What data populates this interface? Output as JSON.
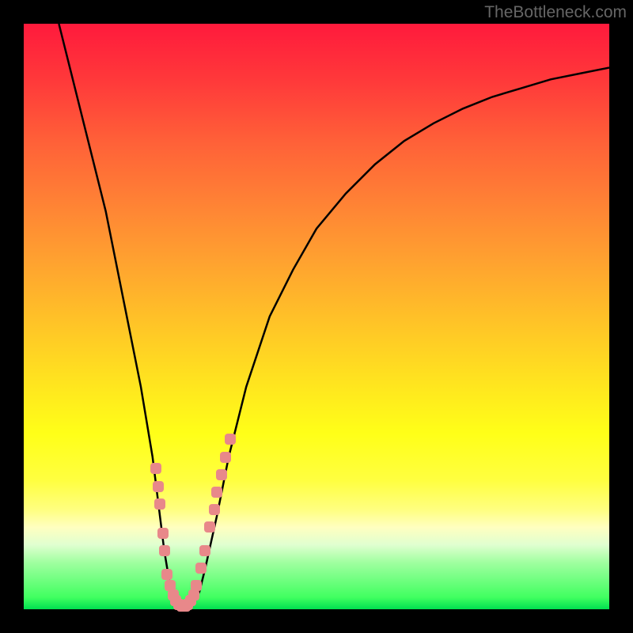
{
  "watermark": "TheBottleneck.com",
  "chart_data": {
    "type": "line",
    "title": "",
    "xlabel": "",
    "ylabel": "",
    "xlim": [
      0,
      100
    ],
    "ylim": [
      0,
      100
    ],
    "curve": [
      {
        "x": 6,
        "y": 100
      },
      {
        "x": 8,
        "y": 92
      },
      {
        "x": 10,
        "y": 84
      },
      {
        "x": 12,
        "y": 76
      },
      {
        "x": 14,
        "y": 68
      },
      {
        "x": 16,
        "y": 58
      },
      {
        "x": 18,
        "y": 48
      },
      {
        "x": 20,
        "y": 38
      },
      {
        "x": 22,
        "y": 26
      },
      {
        "x": 23,
        "y": 18
      },
      {
        "x": 24,
        "y": 10
      },
      {
        "x": 25,
        "y": 4
      },
      {
        "x": 26,
        "y": 1
      },
      {
        "x": 27,
        "y": 0
      },
      {
        "x": 28,
        "y": 0
      },
      {
        "x": 29,
        "y": 1
      },
      {
        "x": 30,
        "y": 3
      },
      {
        "x": 31,
        "y": 7
      },
      {
        "x": 33,
        "y": 16
      },
      {
        "x": 35,
        "y": 26
      },
      {
        "x": 38,
        "y": 38
      },
      {
        "x": 42,
        "y": 50
      },
      {
        "x": 46,
        "y": 58
      },
      {
        "x": 50,
        "y": 65
      },
      {
        "x": 55,
        "y": 71
      },
      {
        "x": 60,
        "y": 76
      },
      {
        "x": 65,
        "y": 80
      },
      {
        "x": 70,
        "y": 83
      },
      {
        "x": 75,
        "y": 85.5
      },
      {
        "x": 80,
        "y": 87.5
      },
      {
        "x": 85,
        "y": 89
      },
      {
        "x": 90,
        "y": 90.5
      },
      {
        "x": 95,
        "y": 91.5
      },
      {
        "x": 100,
        "y": 92.5
      }
    ],
    "markers": [
      {
        "x": 22.5,
        "y": 24
      },
      {
        "x": 23,
        "y": 21
      },
      {
        "x": 23.3,
        "y": 18
      },
      {
        "x": 23.8,
        "y": 13
      },
      {
        "x": 24,
        "y": 10
      },
      {
        "x": 24.5,
        "y": 6
      },
      {
        "x": 25,
        "y": 4
      },
      {
        "x": 25.5,
        "y": 2.5
      },
      {
        "x": 26,
        "y": 1.5
      },
      {
        "x": 26.5,
        "y": 0.8
      },
      {
        "x": 27,
        "y": 0.5
      },
      {
        "x": 27.5,
        "y": 0.5
      },
      {
        "x": 28,
        "y": 0.8
      },
      {
        "x": 28.5,
        "y": 1.5
      },
      {
        "x": 29,
        "y": 2.5
      },
      {
        "x": 29.5,
        "y": 4
      },
      {
        "x": 30.3,
        "y": 7
      },
      {
        "x": 31,
        "y": 10
      },
      {
        "x": 31.8,
        "y": 14
      },
      {
        "x": 32.5,
        "y": 17
      },
      {
        "x": 33,
        "y": 20
      },
      {
        "x": 33.8,
        "y": 23
      },
      {
        "x": 34.5,
        "y": 26
      },
      {
        "x": 35.3,
        "y": 29
      }
    ]
  }
}
